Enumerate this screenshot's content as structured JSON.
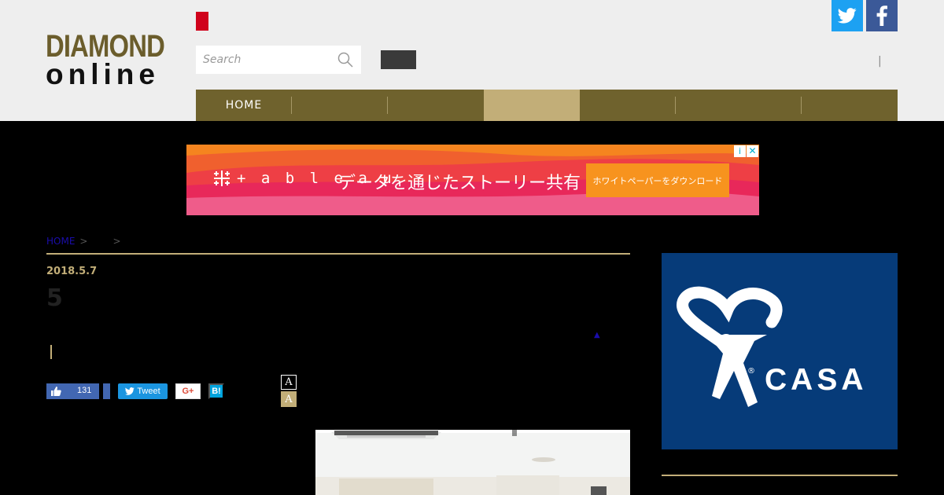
{
  "header": {
    "logo_line1": "DIAMOND",
    "logo_line2": "online",
    "search_placeholder": "Search",
    "pipe": "|",
    "social": {
      "twitter_icon": "twitter-bird-icon",
      "facebook_icon": "facebook-f-icon"
    }
  },
  "nav": {
    "items": [
      {
        "label": "HOME",
        "active": false
      },
      {
        "label": "",
        "active": false
      },
      {
        "label": "",
        "active": false
      },
      {
        "label": "",
        "active": true
      },
      {
        "label": "",
        "active": false
      },
      {
        "label": "",
        "active": false
      },
      {
        "label": "",
        "active": false
      }
    ],
    "bg_color": "#6f622d",
    "active_color": "#c2ae78"
  },
  "ad_banner": {
    "brand": "+ a b l e a u",
    "headline": "データを通じたストーリー共有",
    "cta": "ホワイトペーパーをダウンロード",
    "info_glyph": "i",
    "close_glyph": "✕"
  },
  "breadcrumb": {
    "home": "HOME",
    "sep1": ">",
    "sep2": ">"
  },
  "article": {
    "date": "2018.5.7",
    "title": "5",
    "up_arrow": "▲",
    "accent_color": "#c2ae78"
  },
  "share": {
    "like_count": "131",
    "tweet_label": "Tweet",
    "gplus_label": "G+",
    "hatena_label": "B!",
    "font_small": "A",
    "font_large": "A"
  },
  "sidebar": {
    "ad_text": "CASA",
    "ad_bg": "#063b79"
  }
}
